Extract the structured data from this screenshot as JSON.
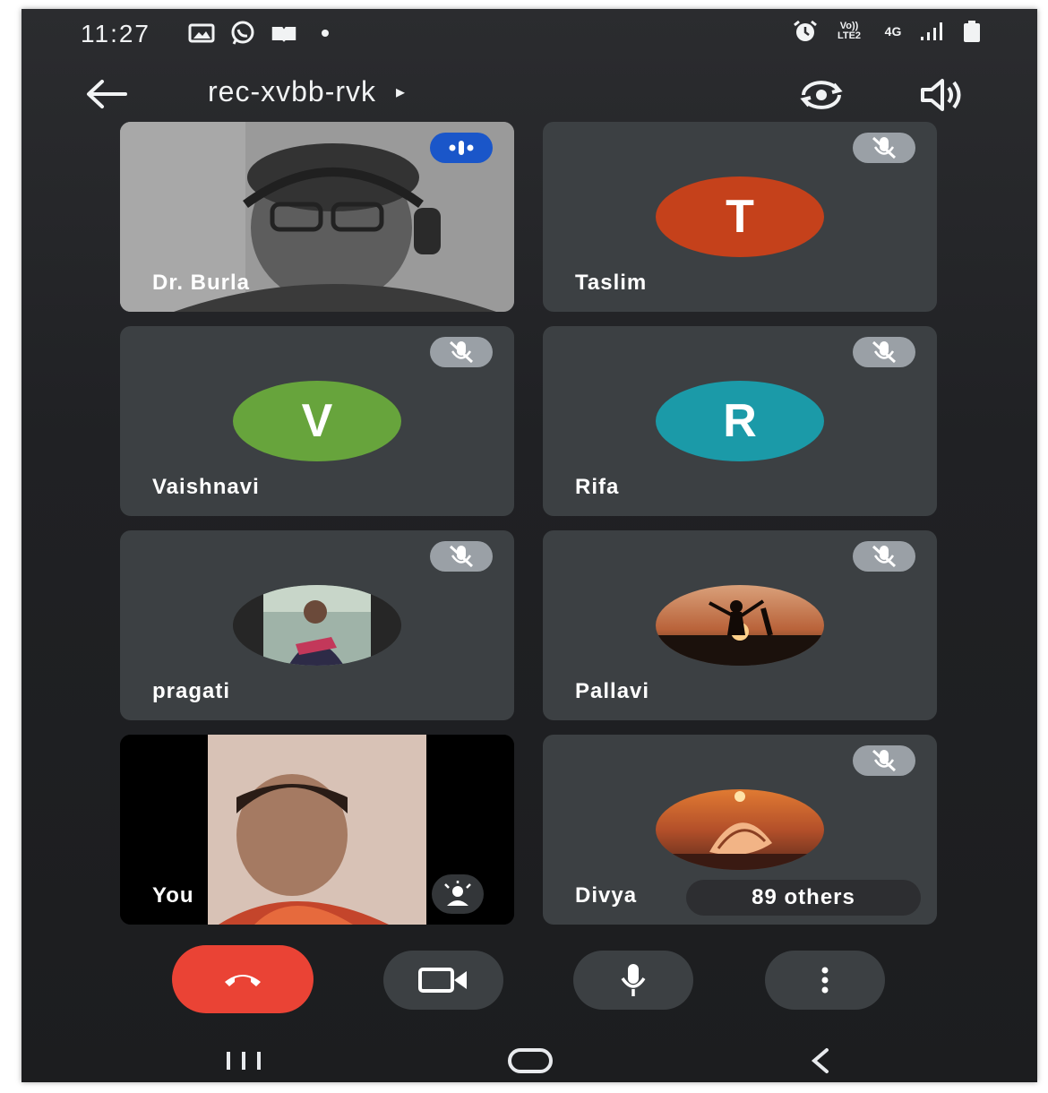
{
  "status_bar": {
    "time": "11:27",
    "left_icons": [
      "gallery-icon",
      "whatsapp-icon",
      "book-icon",
      "notification-dot"
    ],
    "right_icons": [
      "alarm-icon",
      "volte-icon",
      "network-4g-icon",
      "signal-icon",
      "battery-icon"
    ],
    "volte_label": "Vo)) LTE2",
    "network_label": "4G"
  },
  "app_bar": {
    "meeting_code": "rec-xvbb-rvk",
    "caret": "▸",
    "icons": [
      "back-arrow-icon",
      "flip-camera-icon",
      "speaker-icon"
    ]
  },
  "participants": [
    {
      "name": "Dr. Burla",
      "type": "video",
      "status": "speaking"
    },
    {
      "name": "Taslim",
      "type": "initial",
      "initial": "T",
      "avatar_color": "#c5411b",
      "status": "muted"
    },
    {
      "name": "Vaishnavi",
      "type": "initial",
      "initial": "V",
      "avatar_color": "#67a43c",
      "status": "muted"
    },
    {
      "name": "Rifa",
      "type": "initial",
      "initial": "R",
      "avatar_color": "#1b9aa8",
      "status": "muted"
    },
    {
      "name": "pragati",
      "type": "photo",
      "status": "muted"
    },
    {
      "name": "Pallavi",
      "type": "photo",
      "status": "muted"
    },
    {
      "name": "You",
      "type": "video",
      "status": "self"
    },
    {
      "name": "Divya",
      "type": "photo",
      "status": "muted",
      "others_label": "89 others"
    }
  ],
  "controls": {
    "icons": [
      "end-call-icon",
      "camera-icon",
      "microphone-icon",
      "more-options-icon"
    ],
    "end_call_color": "#ea4335"
  },
  "nav_bar": {
    "icons": [
      "recent-apps-icon",
      "home-icon",
      "back-icon"
    ]
  },
  "colors": {
    "background": "#202124",
    "tile": "#3c4043",
    "speaking_badge": "#1a56c9",
    "muted_badge": "#9aa0a6"
  }
}
